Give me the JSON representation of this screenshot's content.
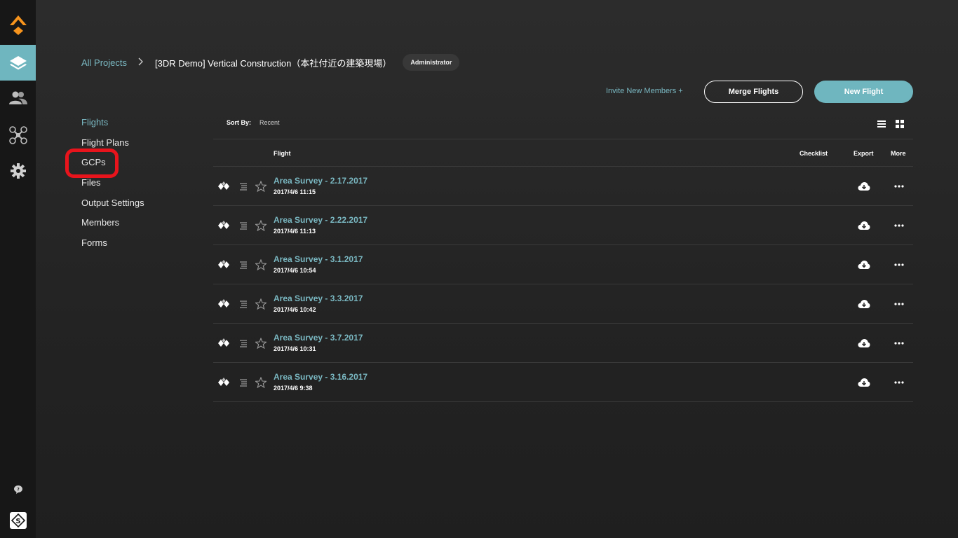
{
  "rail": {
    "items": [
      {
        "icon": "logo-icon"
      },
      {
        "icon": "layers-icon",
        "active": true
      },
      {
        "icon": "members-icon"
      },
      {
        "icon": "drone-icon"
      },
      {
        "icon": "gear-icon"
      }
    ],
    "bottom": [
      {
        "icon": "chat-icon"
      },
      {
        "icon": "site-scan-icon"
      }
    ]
  },
  "breadcrumb": {
    "root": "All Projects",
    "separator": ">",
    "current": "[3DR Demo] Vertical Construction（本社付近の建築現場）",
    "role": "Administrator"
  },
  "actions": {
    "invite": "Invite New Members +",
    "merge": "Merge Flights",
    "new_flight": "New Flight"
  },
  "sidenav": {
    "items": [
      "Flights",
      "Flight Plans",
      "GCPs",
      "Files",
      "Output Settings",
      "Members",
      "Forms"
    ],
    "active_index": 0,
    "highlighted_index": 2
  },
  "sort": {
    "label": "Sort By:",
    "value": "Recent"
  },
  "table": {
    "headers": {
      "flight": "Flight",
      "checklist": "Checklist",
      "export": "Export",
      "more": "More"
    },
    "rows": [
      {
        "name": "Area Survey - 2.17.2017",
        "date": "2017/4/6 11:15"
      },
      {
        "name": "Area Survey - 2.22.2017",
        "date": "2017/4/6 11:13"
      },
      {
        "name": "Area Survey - 3.1.2017",
        "date": "2017/4/6 10:54"
      },
      {
        "name": "Area Survey - 3.3.2017",
        "date": "2017/4/6 10:42"
      },
      {
        "name": "Area Survey - 3.7.2017",
        "date": "2017/4/6 10:31"
      },
      {
        "name": "Area Survey - 3.16.2017",
        "date": "2017/4/6 9:38"
      }
    ]
  },
  "colors": {
    "accent": "#6fb6bf",
    "link": "#7ab8c2",
    "logo": "#f7941d",
    "highlight": "#e8141c",
    "rail_bg": "#171717",
    "main_bg": "#262626"
  }
}
